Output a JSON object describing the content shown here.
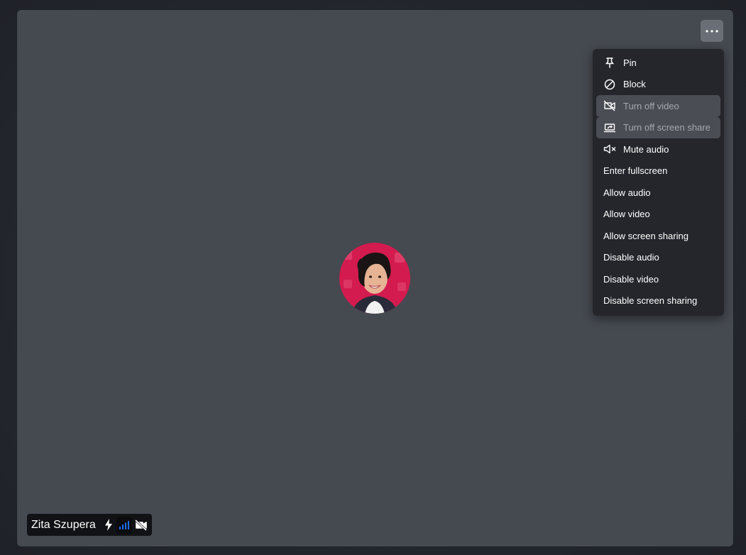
{
  "participant": {
    "name": "Zita Szupera",
    "avatar_description_icon": "participant-avatar"
  },
  "header": {
    "more_options_icon": "more-horizontal-icon"
  },
  "menu": {
    "items": [
      {
        "label": "Pin",
        "icon": "pin-icon",
        "disabled": false
      },
      {
        "label": "Block",
        "icon": "block-icon",
        "disabled": false
      },
      {
        "label": "Turn off video",
        "icon": "video-off-icon",
        "disabled": true
      },
      {
        "label": "Turn off screen share",
        "icon": "screen-share-off-icon",
        "disabled": true
      },
      {
        "label": "Mute audio",
        "icon": "speaker-mute-icon",
        "disabled": false
      },
      {
        "label": "Enter fullscreen",
        "icon": "",
        "disabled": false
      },
      {
        "label": "Allow audio",
        "icon": "",
        "disabled": false
      },
      {
        "label": "Allow video",
        "icon": "",
        "disabled": false
      },
      {
        "label": "Allow screen sharing",
        "icon": "",
        "disabled": false
      },
      {
        "label": "Disable audio",
        "icon": "",
        "disabled": false
      },
      {
        "label": "Disable video",
        "icon": "",
        "disabled": false
      },
      {
        "label": "Disable screen sharing",
        "icon": "",
        "disabled": false
      }
    ]
  },
  "colors": {
    "tile_bg": "#454950",
    "menu_bg": "#24262b",
    "signal_blue": "#1f6fff",
    "avatar_bg": "#d31b4f"
  }
}
